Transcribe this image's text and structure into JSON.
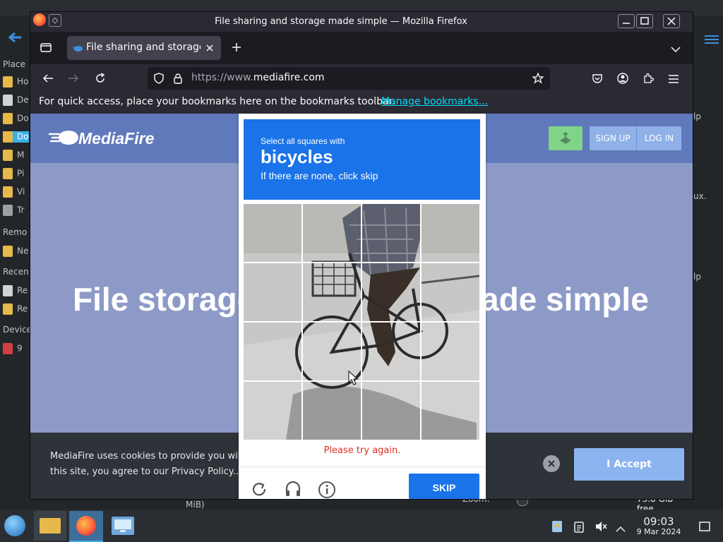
{
  "window": {
    "title": "File sharing and storage made simple — Mozilla Firefox"
  },
  "tab": {
    "label": "File sharing and storage"
  },
  "urlbar": {
    "url_prefix": "https://www.",
    "url_domain": "mediafire.com"
  },
  "bookmarks_bar": {
    "message": "For quick access, place your bookmarks here on the bookmarks toolbar.",
    "link": "Manage bookmarks…"
  },
  "page": {
    "logo": "MediaFire",
    "signup": "SIGN UP",
    "login": "LOG IN",
    "hero_left": "File storage",
    "hero_right": "ade simple",
    "cookie_text_line1": "MediaFire uses cookies to provide you with a",
    "cookie_text_line2": "this site, you agree to our Privacy Policy..",
    "accept": "I Accept"
  },
  "captcha": {
    "instruction": "Select all squares with",
    "target": "bicycles",
    "hint": "If there are none, click skip",
    "error": "Please try again.",
    "skip": "SKIP"
  },
  "dolphin_sidebar": {
    "places_header": "Place",
    "items": [
      "Ho",
      "De",
      "Do",
      "Do",
      "M",
      "Pi",
      "Vi",
      "Tr"
    ],
    "remote_header": "Remo",
    "remote_items": [
      "Ne"
    ],
    "recent_header": "Recen",
    "recent_items": [
      "Re",
      "Re"
    ],
    "devices_header": "Device",
    "device_items": [
      "9"
    ]
  },
  "dolphin_right": {
    "snippets": [
      "lp",
      "ux.",
      "lp"
    ]
  },
  "dolphin_bottom": {
    "info": "MiB)",
    "zoom_label": "Zoom:",
    "free_space": "73.8 GiB free"
  },
  "taskbar": {
    "time": "09:03",
    "date": "9 Mar 2024"
  },
  "colors": {
    "captcha_blue": "#1a73e8",
    "error_red": "#d93025",
    "accept_bg": "#8bb4f0",
    "page_bg": "#8d9ac7"
  }
}
